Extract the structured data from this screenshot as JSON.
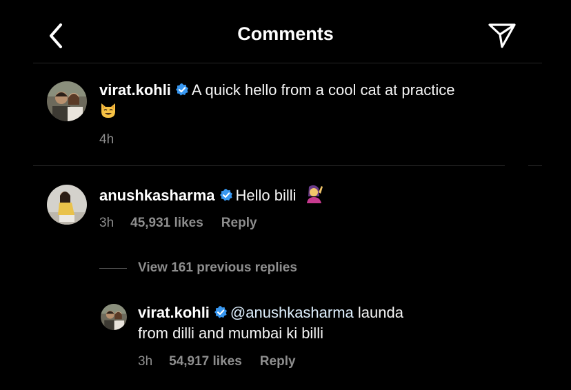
{
  "header": {
    "title": "Comments"
  },
  "caption": {
    "username": "virat.kohli",
    "text": "A quick hello from a cool cat at practice",
    "emoji": "😺",
    "time": "4h"
  },
  "comments": [
    {
      "username": "anushkasharma",
      "text": "Hello billi",
      "emoji": "🙋‍♀️",
      "time": "3h",
      "likes": "45,931 likes",
      "reply_label": "Reply"
    }
  ],
  "view_replies_label": "View 161 previous replies",
  "replies": [
    {
      "username": "virat.kohli",
      "mention": "@anushkasharma",
      "text_line1": "launda",
      "text_line2": "from dilli and mumbai ki billi",
      "time": "3h",
      "likes": "54,917 likes",
      "reply_label": "Reply"
    }
  ],
  "colors": {
    "background": "#000000",
    "text": "#f5f5f5",
    "muted": "#8e8e8e",
    "verified": "#3897f0",
    "mention": "#e0f1ff"
  }
}
